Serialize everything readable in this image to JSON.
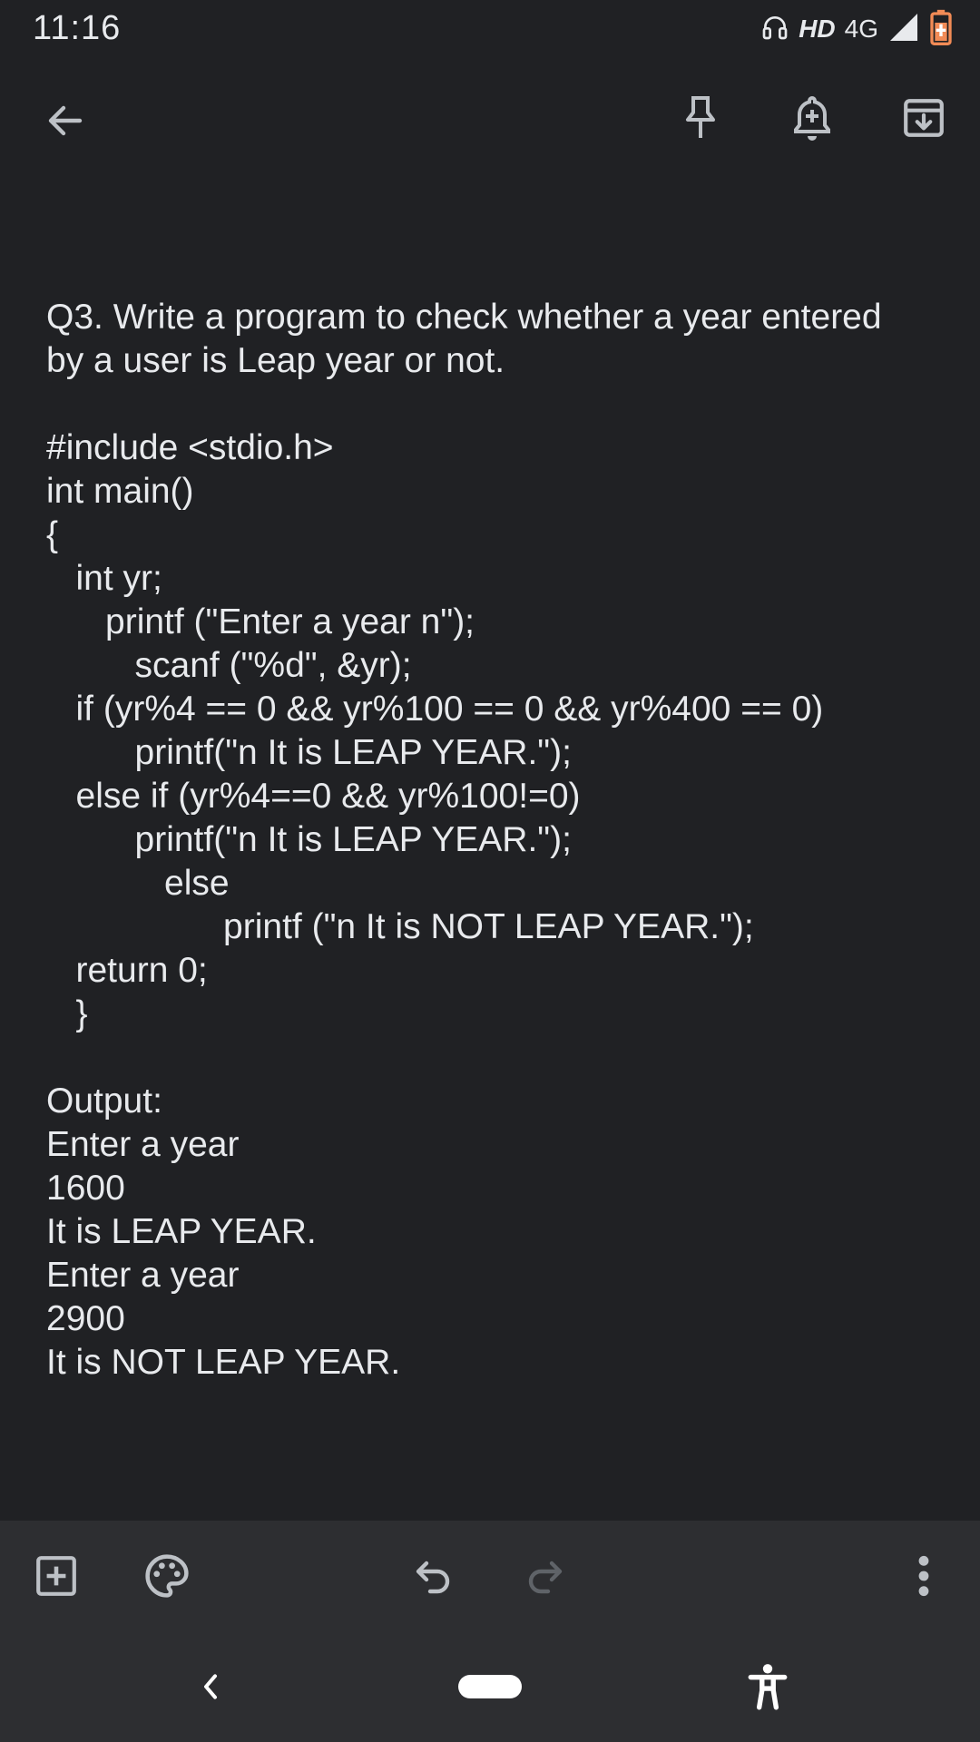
{
  "status_bar": {
    "time": "11:16",
    "hd_label": "HD",
    "network_label": "4G",
    "icons": [
      "headset-icon",
      "signal-icon",
      "battery-charging-icon"
    ]
  },
  "top_bar": {
    "icons": [
      "back-arrow-icon",
      "pin-icon",
      "reminder-bell-icon",
      "archive-icon"
    ]
  },
  "note": {
    "title_lines": [
      "Q3. Write a program to check whether a year entered",
      "by a user is Leap year or not."
    ],
    "code_lines": [
      "#include <stdio.h>",
      "int main()",
      "{",
      "   int yr;",
      "      printf (\"Enter a year n\");",
      "         scanf (\"%d\", &yr);",
      "   if (yr%4 == 0 && yr%100 == 0 && yr%400 == 0)",
      "         printf(\"n It is LEAP YEAR.\");",
      "   else if (yr%4==0 && yr%100!=0)",
      "         printf(\"n It is LEAP YEAR.\");",
      "            else",
      "                  printf (\"n It is NOT LEAP YEAR.\");",
      "   return 0;",
      "   }"
    ],
    "output_lines": [
      "Output:",
      "Enter a year",
      "1600",
      "It is LEAP YEAR.",
      "Enter a year",
      "2900",
      "It is NOT LEAP YEAR."
    ]
  },
  "bottom_toolbar": {
    "icons": [
      "add-box-icon",
      "palette-icon",
      "undo-icon",
      "redo-icon",
      "more-vert-icon"
    ]
  },
  "nav_bar": {
    "icons": [
      "nav-back-icon",
      "home-pill",
      "accessibility-icon"
    ]
  },
  "colors": {
    "background": "#202124",
    "toolbar": "#2d2e31",
    "text": "#e8eaed",
    "icon": "#bdc1c6",
    "battery_accent": "#f28b56"
  }
}
